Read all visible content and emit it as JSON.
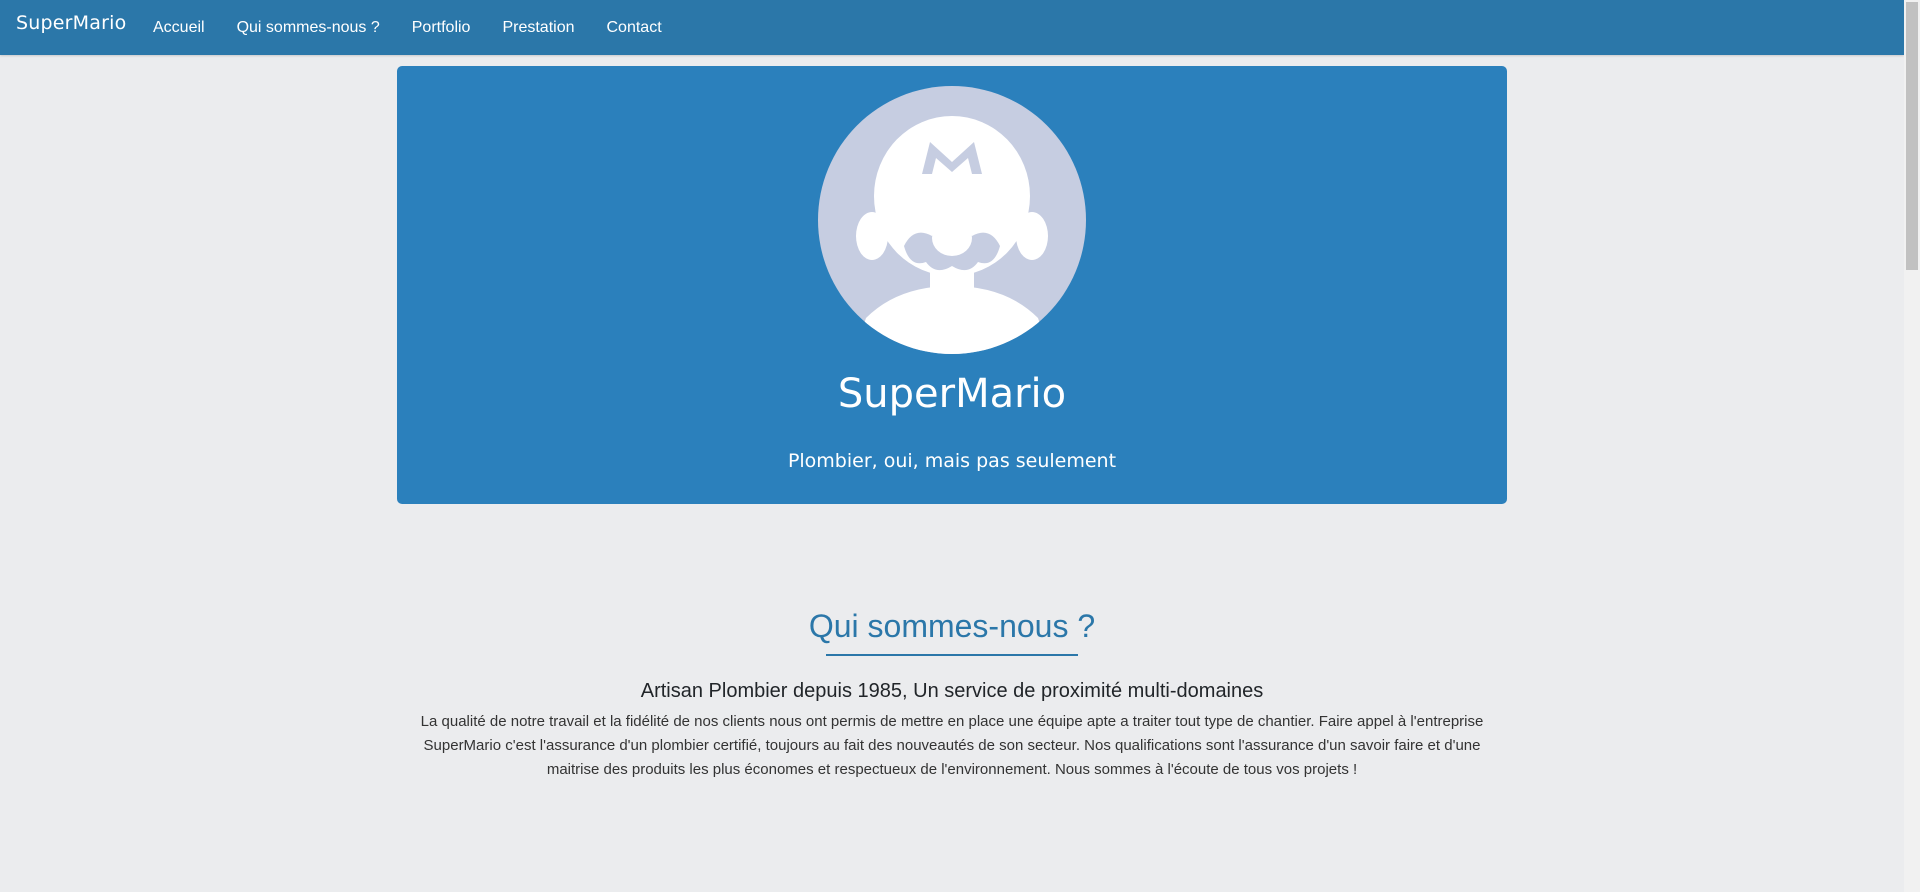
{
  "navbar": {
    "brand": "SuperMario",
    "links": [
      "Accueil",
      "Qui sommes-nous ?",
      "Portfolio",
      "Prestation",
      "Contact"
    ]
  },
  "hero": {
    "title": "SuperMario",
    "subtitle": "Plombier, oui, mais pas seulement",
    "avatar_icon": "plumber-avatar-icon"
  },
  "about": {
    "heading": "Qui sommes-nous ?",
    "subheading": "Artisan Plombier depuis 1985, Un service de proximité multi-domaines",
    "text": "La qualité de notre travail et la fidélité de nos clients nous ont permis de mettre en place une équipe apte a traiter tout type de chantier. Faire appel à l'entreprise SuperMario c'est l'assurance d'un plombier certifié, toujours au fait des nouveautés de son secteur. Nos qualifications sont l'assurance d'un savoir faire et d'une maitrise des produits les plus économes et respectueux de l'environnement. Nous sommes à l'écoute de tous vos projets !"
  },
  "colors": {
    "navbar": "#2b77a9",
    "hero": "#2b80bc",
    "avatar_bg": "#c6cde1",
    "page_bg": "#ebecee",
    "heading": "#2b77a9"
  }
}
